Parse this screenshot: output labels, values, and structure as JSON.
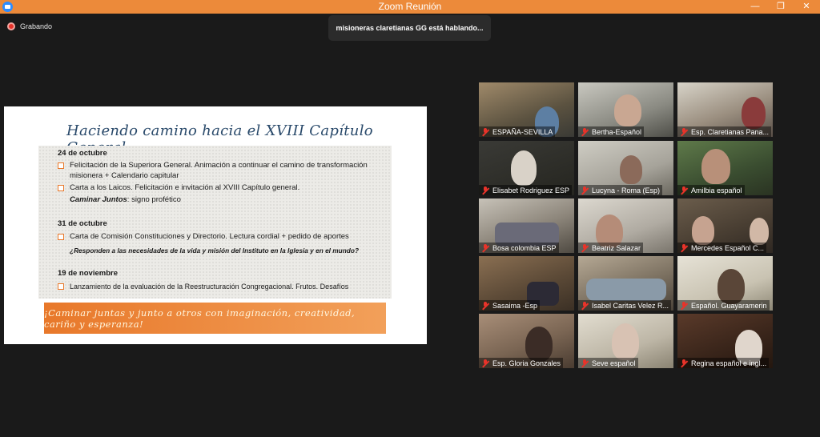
{
  "window": {
    "title": "Zoom Reunión"
  },
  "recording": {
    "label": "Grabando"
  },
  "toast": {
    "text": "misioneras claretianas GG está hablando..."
  },
  "slide": {
    "title": "Haciendo camino hacia el XVIII Capítulo General",
    "sections": [
      {
        "date": "24 de octubre",
        "bullets": [
          "Felicitación de la Superiora General. Animación a continuar el camino de transformación misionera + Calendario capitular",
          "Carta a los Laicos. Felicitación e invitación al XVIII Capítulo general."
        ],
        "note_bold": "Caminar Juntos",
        "note_rest": ": signo profético"
      },
      {
        "date": "31 de octubre",
        "bullets": [
          "Carta de Comisión Constituciones y Directorio. Lectura cordial + pedido de aportes"
        ],
        "note": "¿Responden a las necesidades de la vida y misión del Instituto en la Iglesia y en el mundo?"
      },
      {
        "date": "19 de noviembre",
        "bullets": [
          "Lanzamiento de la evaluación de la Reestructuración Congregacional. Frutos. Desafíos"
        ]
      }
    ],
    "banner": "¡Caminar juntas y junto a otros con imaginación, creatividad, cariño y esperanza!"
  },
  "participants": [
    {
      "name": "ESPAÑA-SEVILLA"
    },
    {
      "name": "Bertha-Español"
    },
    {
      "name": "Esp. Claretianas Pana..."
    },
    {
      "name": "Elisabet Rodriguez ESP"
    },
    {
      "name": "Lucyna - Roma (Esp)"
    },
    {
      "name": "Amilbia español"
    },
    {
      "name": "Bosa colombia ESP"
    },
    {
      "name": "Beatriz Salazar"
    },
    {
      "name": "Mercedes Español C..."
    },
    {
      "name": "Sasaima -Esp"
    },
    {
      "name": "Isabel Caritas Velez R..."
    },
    {
      "name": "Español. Guayaramerin"
    },
    {
      "name": "Esp. Gloria Gonzales"
    },
    {
      "name": "Seve español"
    },
    {
      "name": "Regina español e ingl..."
    }
  ]
}
